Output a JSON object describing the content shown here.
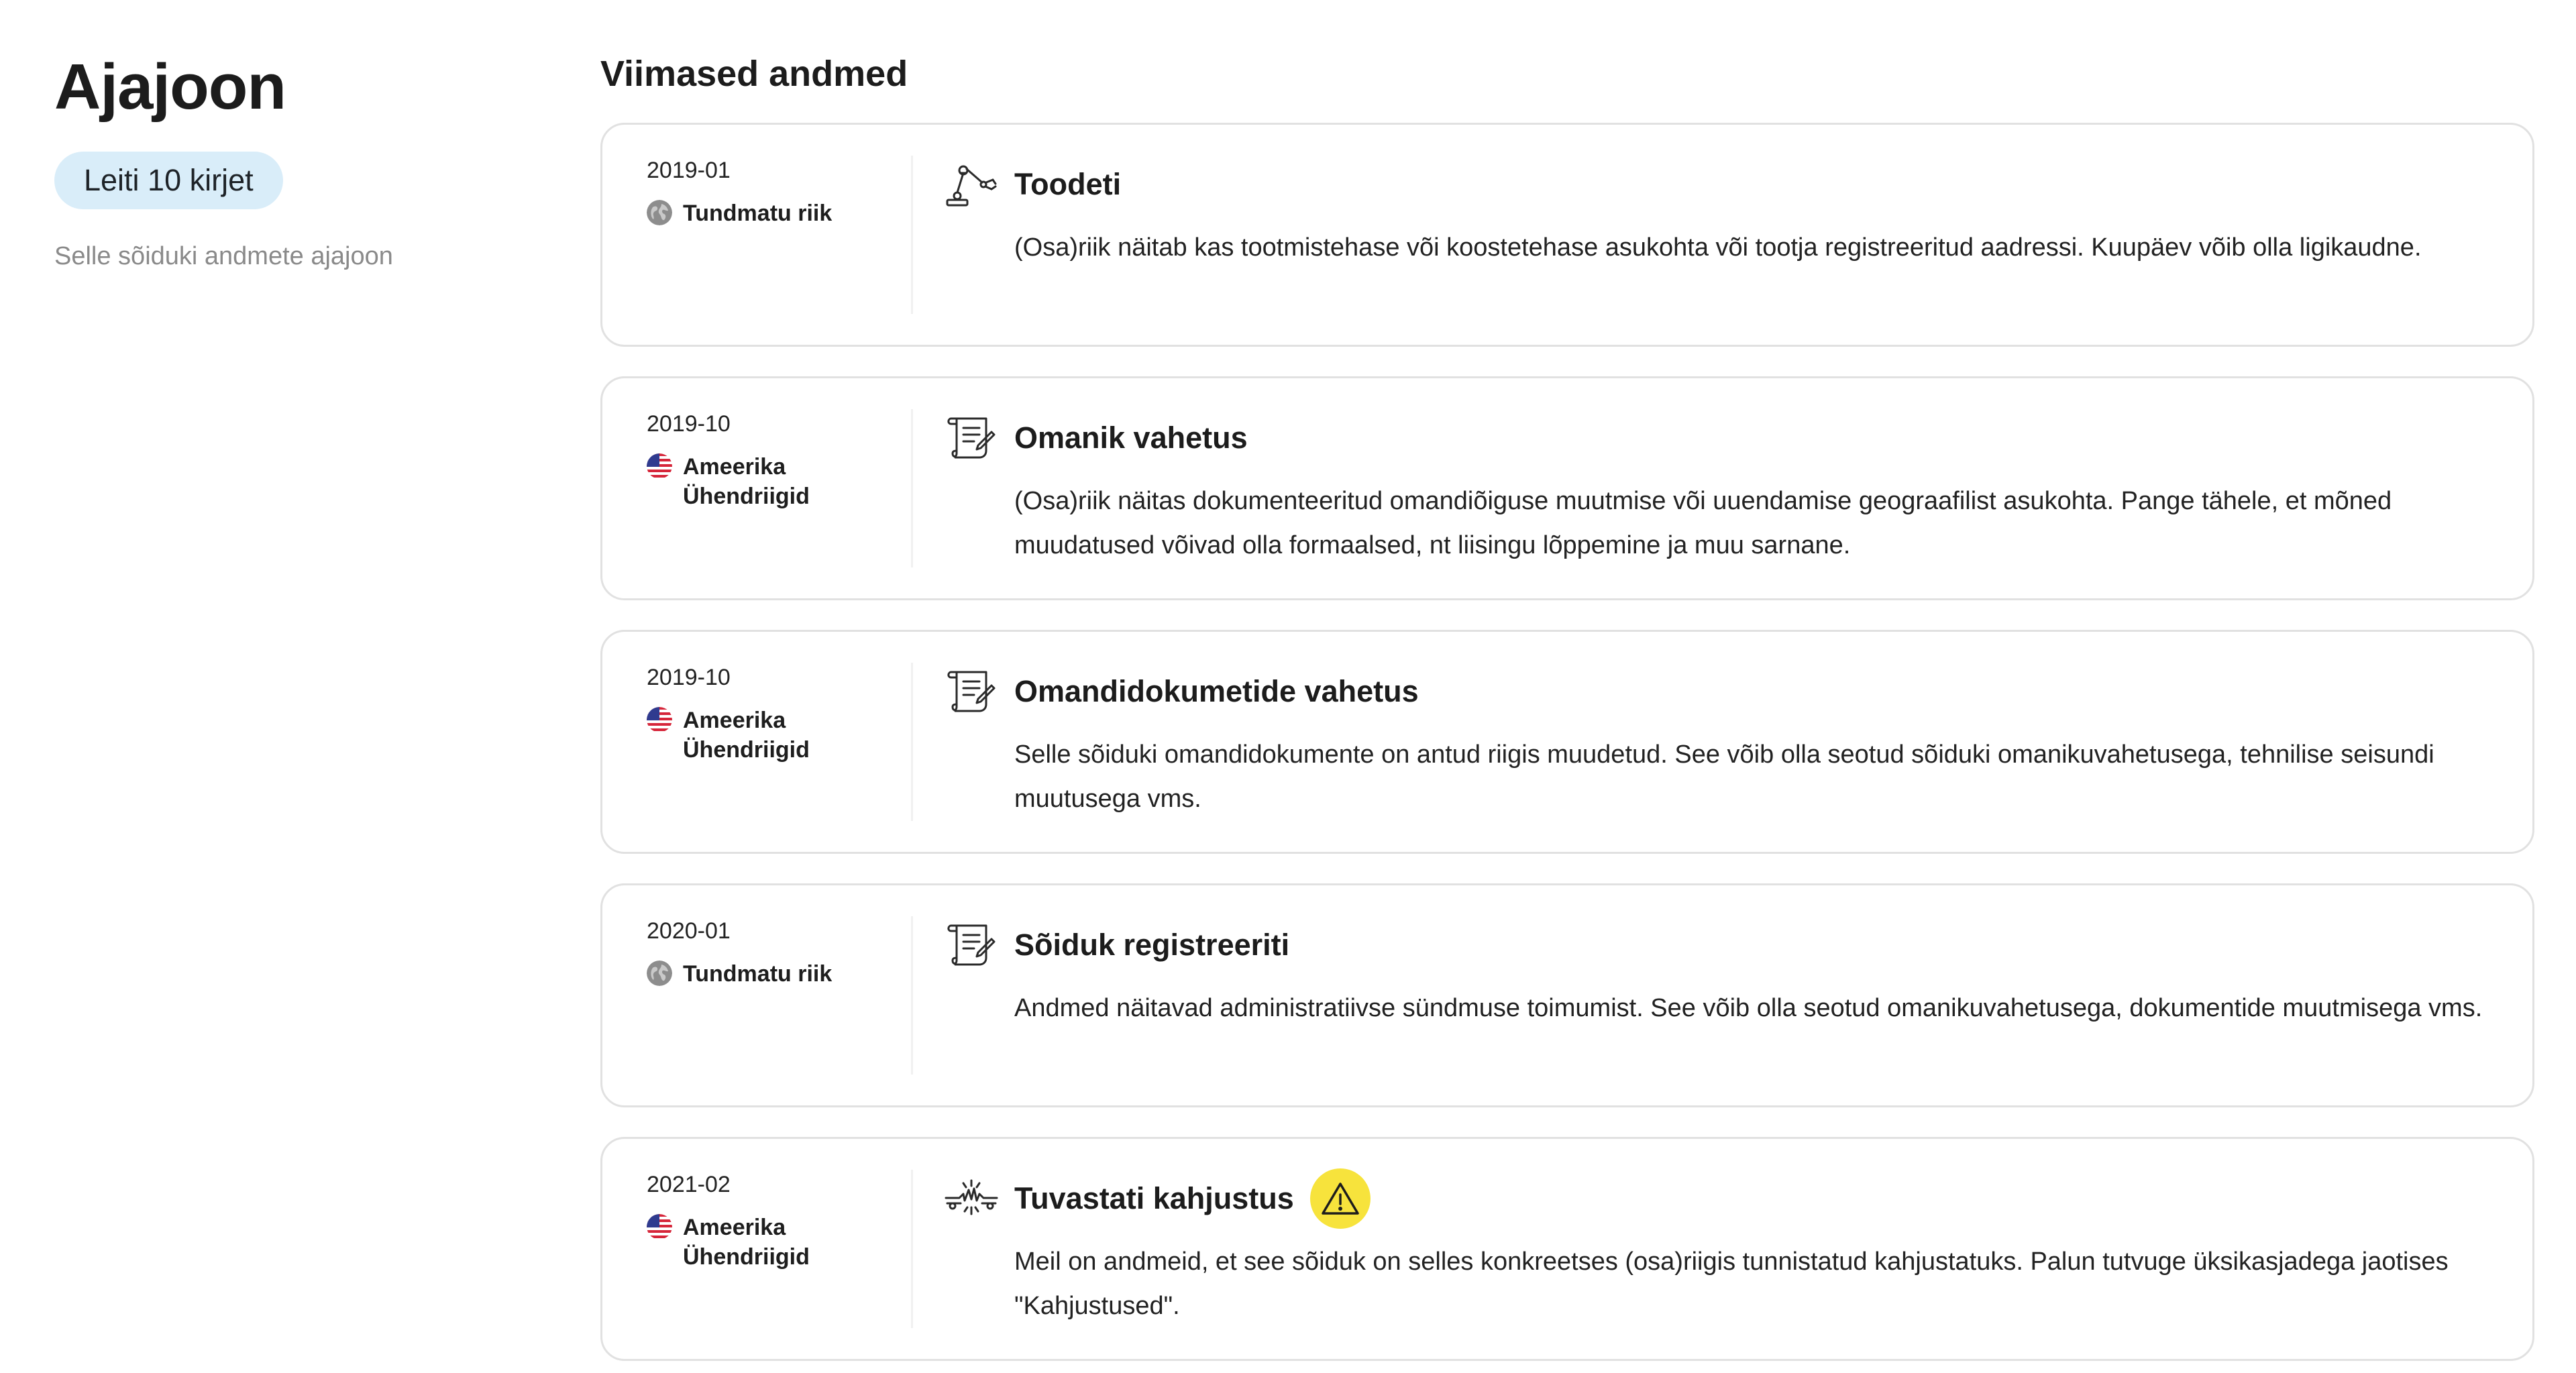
{
  "sidebar": {
    "title": "Ajajoon",
    "count_badge": "Leiti 10 kirjet",
    "subtitle": "Selle sõiduki andmete ajajoon"
  },
  "main": {
    "section_title": "Viimased andmed",
    "events": [
      {
        "date": "2019-01",
        "country": "Tundmatu riik",
        "flag": "globe-icon",
        "icon": "robot-arm-icon",
        "title": "Toodeti",
        "warning": false,
        "description": "(Osa)riik näitab kas tootmistehase või koostetehase asukohta või tootja registreeritud aadressi. Kuupäev võib olla ligikaudne."
      },
      {
        "date": "2019-10",
        "country": "Ameerika Ühendriigid",
        "flag": "us-flag-icon",
        "icon": "document-scroll-icon",
        "title": "Omanik vahetus",
        "warning": false,
        "description": "(Osa)riik näitas dokumenteeritud omandiõiguse muutmise või uuendamise geograafilist asukohta. Pange tähele, et mõned muudatused võivad olla formaalsed, nt liisingu lõppemine ja muu sarnane."
      },
      {
        "date": "2019-10",
        "country": "Ameerika Ühendriigid",
        "flag": "us-flag-icon",
        "icon": "document-scroll-icon",
        "title": "Omandidokumetide vahetus",
        "warning": false,
        "description": "Selle sõiduki omandidokumente on antud riigis muudetud. See võib olla seotud sõiduki omanikuvahetusega, tehnilise seisundi muutusega vms."
      },
      {
        "date": "2020-01",
        "country": "Tundmatu riik",
        "flag": "globe-icon",
        "icon": "document-scroll-icon",
        "title": "Sõiduk registreeriti",
        "warning": false,
        "description": "Andmed näitavad administratiivse sündmuse toimumist. See võib olla seotud omanikuvahetusega, dokumentide muutmisega vms."
      },
      {
        "date": "2021-02",
        "country": "Ameerika Ühendriigid",
        "flag": "us-flag-icon",
        "icon": "crash-icon",
        "title": "Tuvastati kahjustus",
        "warning": true,
        "warning_icon": "warning-triangle-icon",
        "warning_color": "#f7e33c",
        "description": "Meil on andmeid, et see sõiduk on selles konkreetses (osa)riigis tunnistatud kahjustatuks. Palun tutvuge üksikasjadega jaotises \"Kahjustused\"."
      }
    ]
  },
  "colors": {
    "badge_bg": "#d9edf9",
    "card_border": "#e1e1e1",
    "muted_text": "#8a8a8a"
  }
}
